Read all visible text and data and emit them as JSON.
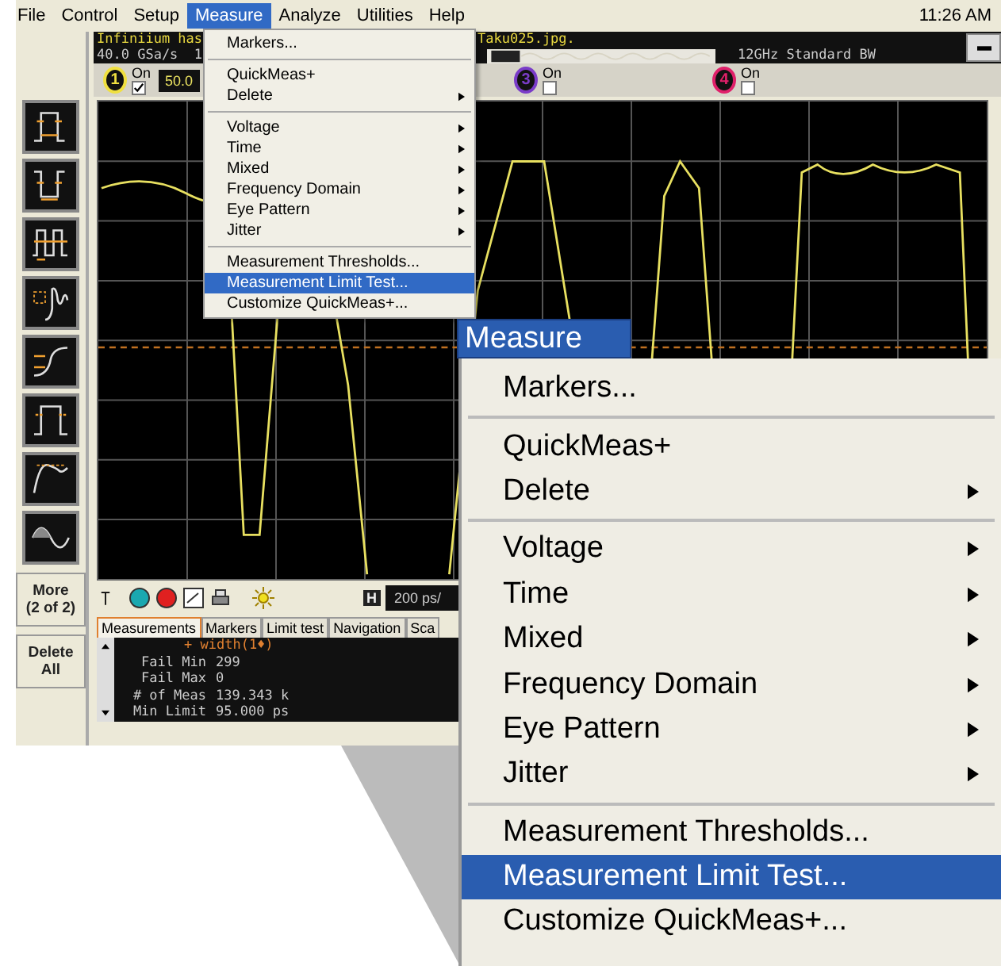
{
  "menu_bar": {
    "items": [
      {
        "label": "File",
        "selected": false
      },
      {
        "label": "Control",
        "selected": false
      },
      {
        "label": "Setup",
        "selected": false
      },
      {
        "label": "Measure",
        "selected": true
      },
      {
        "label": "Analyze",
        "selected": false
      },
      {
        "label": "Utilities",
        "selected": false
      },
      {
        "label": "Help",
        "selected": false
      }
    ],
    "clock": "11:26 AM"
  },
  "scope": {
    "header": {
      "title_left": "Infiniium has",
      "title_right": "Taku025.jpg.",
      "rate": "40.0 GSa/s  1",
      "bandwidth": "12GHz Standard BW"
    },
    "channels": [
      {
        "number": "1",
        "on_label": "On",
        "checked": true,
        "color": "#f0e040"
      },
      {
        "number": "3",
        "on_label": "On",
        "checked": false,
        "color": "#7a3cc8"
      },
      {
        "number": "4",
        "on_label": "On",
        "checked": false,
        "color": "#e0206a"
      }
    ],
    "scale": "50.0",
    "timebase_label": "H",
    "timebase": "200 ps/",
    "tabs": [
      {
        "label": "Measurements",
        "selected": true
      },
      {
        "label": "Markers",
        "selected": false
      },
      {
        "label": "Limit test",
        "selected": false
      },
      {
        "label": "Navigation",
        "selected": false
      },
      {
        "label": "Sca",
        "selected": false
      }
    ],
    "measurement": {
      "title": "+ width(1♦)",
      "rows": [
        {
          "label": "Fail Min",
          "value": "299"
        },
        {
          "label": "Fail Max",
          "value": "0"
        },
        {
          "label": "# of Meas",
          "value": "139.343 k"
        },
        {
          "label": "Min Limit",
          "value": "95.000 ps"
        }
      ]
    }
  },
  "side_buttons": [
    "More\n(2 of 2)",
    "Delete\nAll"
  ],
  "measure_menu": {
    "items": [
      {
        "kind": "item",
        "label": "Markers...",
        "submenu": false,
        "selected": false
      },
      {
        "kind": "separator"
      },
      {
        "kind": "item",
        "label": "QuickMeas+",
        "submenu": false,
        "selected": false
      },
      {
        "kind": "item",
        "label": "Delete",
        "submenu": true,
        "selected": false
      },
      {
        "kind": "separator"
      },
      {
        "kind": "item",
        "label": "Voltage",
        "submenu": true,
        "selected": false
      },
      {
        "kind": "item",
        "label": "Time",
        "submenu": true,
        "selected": false
      },
      {
        "kind": "item",
        "label": "Mixed",
        "submenu": true,
        "selected": false
      },
      {
        "kind": "item",
        "label": "Frequency Domain",
        "submenu": true,
        "selected": false
      },
      {
        "kind": "item",
        "label": "Eye Pattern",
        "submenu": true,
        "selected": false
      },
      {
        "kind": "item",
        "label": "Jitter",
        "submenu": true,
        "selected": false
      },
      {
        "kind": "separator"
      },
      {
        "kind": "item",
        "label": "Measurement Thresholds...",
        "submenu": false,
        "selected": false
      },
      {
        "kind": "item",
        "label": "Measurement Limit Test...",
        "submenu": false,
        "selected": true
      },
      {
        "kind": "item",
        "label": "Customize QuickMeas+...",
        "submenu": false,
        "selected": false
      }
    ]
  },
  "zoomed_menu": {
    "title": "Measure",
    "items": [
      {
        "kind": "item",
        "label": "Markers...",
        "submenu": false,
        "selected": false
      },
      {
        "kind": "separator"
      },
      {
        "kind": "item",
        "label": "QuickMeas+",
        "submenu": false,
        "selected": false
      },
      {
        "kind": "item",
        "label": "Delete",
        "submenu": true,
        "selected": false
      },
      {
        "kind": "separator"
      },
      {
        "kind": "item",
        "label": "Voltage",
        "submenu": true,
        "selected": false
      },
      {
        "kind": "item",
        "label": "Time",
        "submenu": true,
        "selected": false
      },
      {
        "kind": "item",
        "label": "Mixed",
        "submenu": true,
        "selected": false
      },
      {
        "kind": "item",
        "label": "Frequency Domain",
        "submenu": true,
        "selected": false
      },
      {
        "kind": "item",
        "label": "Eye Pattern",
        "submenu": true,
        "selected": false
      },
      {
        "kind": "item",
        "label": "Jitter",
        "submenu": true,
        "selected": false
      },
      {
        "kind": "separator"
      },
      {
        "kind": "item",
        "label": "Measurement Thresholds...",
        "submenu": false,
        "selected": false
      },
      {
        "kind": "item",
        "label": "Measurement Limit Test...",
        "submenu": false,
        "selected": true
      },
      {
        "kind": "item",
        "label": "Customize QuickMeas+...",
        "submenu": false,
        "selected": false
      }
    ]
  }
}
